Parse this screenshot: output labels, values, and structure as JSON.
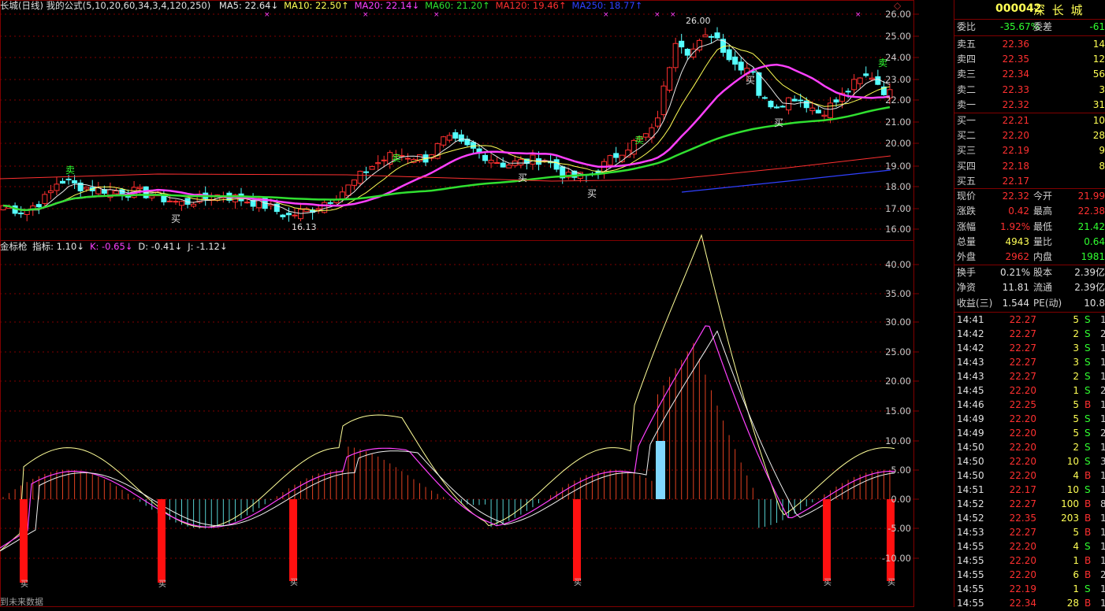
{
  "header": {
    "title": "长城(日线) 我的公式(5,10,20,60,34,3,4,120,250)",
    "ma": [
      {
        "label": "MA5: 22.64",
        "arrow": "↓",
        "color": "#e8e8e8"
      },
      {
        "label": "MA10: 22.50",
        "arrow": "↑",
        "color": "#ffff55"
      },
      {
        "label": "MA20: 22.14",
        "arrow": "↓",
        "color": "#ff40ff"
      },
      {
        "label": "MA60: 21.20",
        "arrow": "↑",
        "color": "#30e030"
      },
      {
        "label": "MA120: 19.46",
        "arrow": "↑",
        "color": "#ff3030"
      },
      {
        "label": "MA250: 18.77",
        "arrow": "↑",
        "color": "#3040ff"
      }
    ],
    "corner_icon": "diamond-icon"
  },
  "indicator": {
    "name": "金标枪",
    "items": [
      {
        "label": "指标: 1.10",
        "arrow": "↓",
        "color": "#e8e8e8"
      },
      {
        "label": "K: -0.65",
        "arrow": "↓",
        "color": "#ff40ff"
      },
      {
        "label": "D: -0.41",
        "arrow": "↓",
        "color": "#e8e8e8"
      },
      {
        "label": "J: -1.12",
        "arrow": "↓",
        "color": "#e8e8e8"
      }
    ]
  },
  "footer_text": "到未来数据",
  "price_axis": [
    "26.00",
    "25.00",
    "24.00",
    "23.00",
    "22.00",
    "21.00",
    "20.00",
    "19.00",
    "18.00",
    "17.00",
    "16.00"
  ],
  "indicator_axis": [
    "40.00",
    "35.00",
    "30.00",
    "25.00",
    "20.00",
    "15.00",
    "10.00",
    "5.00",
    "0.00",
    "-5.00",
    "-10.00"
  ],
  "annotations": {
    "high": "26.00",
    "low": "16.13",
    "buy": "买",
    "sell": "卖",
    "buy_marker": "买"
  },
  "quote": {
    "code": "000042",
    "name": "深 长 城",
    "ratio": {
      "label": "委比",
      "value": "-35.67%",
      "label2": "委差",
      "value2": "-61"
    },
    "asks": [
      {
        "label": "卖五",
        "price": "22.36",
        "vol": "14"
      },
      {
        "label": "卖四",
        "price": "22.35",
        "vol": "12"
      },
      {
        "label": "卖三",
        "price": "22.34",
        "vol": "56"
      },
      {
        "label": "卖二",
        "price": "22.33",
        "vol": "3"
      },
      {
        "label": "卖一",
        "price": "22.32",
        "vol": "31"
      }
    ],
    "bids": [
      {
        "label": "买一",
        "price": "22.21",
        "vol": "10"
      },
      {
        "label": "买二",
        "price": "22.20",
        "vol": "28"
      },
      {
        "label": "买三",
        "price": "22.19",
        "vol": "9"
      },
      {
        "label": "买四",
        "price": "22.18",
        "vol": "8"
      },
      {
        "label": "买五",
        "price": "22.17",
        "vol": ""
      }
    ],
    "stats": [
      {
        "l1": "现价",
        "v1": "22.32",
        "c1": "red",
        "l2": "今开",
        "v2": "21.99",
        "c2": "red"
      },
      {
        "l1": "涨跌",
        "v1": "0.42",
        "c1": "red",
        "l2": "最高",
        "v2": "22.38",
        "c2": "red"
      },
      {
        "l1": "涨幅",
        "v1": "1.92%",
        "c1": "red",
        "l2": "最低",
        "v2": "21.42",
        "c2": "green"
      },
      {
        "l1": "总量",
        "v1": "4943",
        "c1": "yellow",
        "l2": "量比",
        "v2": "0.64",
        "c2": "green"
      },
      {
        "l1": "外盘",
        "v1": "2962",
        "c1": "red",
        "l2": "内盘",
        "v2": "1981",
        "c2": "green"
      }
    ],
    "stats2": [
      {
        "l1": "换手",
        "v1": "0.21%",
        "l2": "股本",
        "v2": "2.39亿"
      },
      {
        "l1": "净资",
        "v1": "11.81",
        "l2": "流通",
        "v2": "2.39亿"
      },
      {
        "l1": "收益(三)",
        "v1": "1.544",
        "l2": "PE(动)",
        "v2": "10.8"
      }
    ]
  },
  "ticks": [
    {
      "t": "14:41",
      "p": "22.27",
      "v": "5",
      "f": "S",
      "x": "1"
    },
    {
      "t": "14:42",
      "p": "22.27",
      "v": "2",
      "f": "S",
      "x": "2"
    },
    {
      "t": "14:42",
      "p": "22.27",
      "v": "3",
      "f": "S",
      "x": "1"
    },
    {
      "t": "14:43",
      "p": "22.27",
      "v": "3",
      "f": "S",
      "x": "1"
    },
    {
      "t": "14:43",
      "p": "22.27",
      "v": "2",
      "f": "S",
      "x": "1"
    },
    {
      "t": "14:45",
      "p": "22.20",
      "v": "1",
      "f": "S",
      "x": "2"
    },
    {
      "t": "14:46",
      "p": "22.25",
      "v": "5",
      "f": "B",
      "x": "1"
    },
    {
      "t": "14:49",
      "p": "22.20",
      "v": "5",
      "f": "S",
      "x": "1"
    },
    {
      "t": "14:49",
      "p": "22.20",
      "v": "5",
      "f": "S",
      "x": "2"
    },
    {
      "t": "14:50",
      "p": "22.20",
      "v": "2",
      "f": "S",
      "x": "1"
    },
    {
      "t": "14:50",
      "p": "22.20",
      "v": "10",
      "f": "S",
      "x": "3"
    },
    {
      "t": "14:50",
      "p": "22.20",
      "v": "4",
      "f": "B",
      "x": "1"
    },
    {
      "t": "14:51",
      "p": "22.17",
      "v": "10",
      "f": "S",
      "x": "1"
    },
    {
      "t": "14:52",
      "p": "22.27",
      "v": "100",
      "f": "B",
      "x": "8"
    },
    {
      "t": "14:52",
      "p": "22.35",
      "v": "203",
      "f": "B",
      "x": "19"
    },
    {
      "t": "14:53",
      "p": "22.27",
      "v": "5",
      "f": "B",
      "x": "1"
    },
    {
      "t": "14:55",
      "p": "22.20",
      "v": "4",
      "f": "S",
      "x": "1"
    },
    {
      "t": "14:55",
      "p": "22.20",
      "v": "1",
      "f": "B",
      "x": "1"
    },
    {
      "t": "14:55",
      "p": "22.20",
      "v": "6",
      "f": "B",
      "x": "2"
    },
    {
      "t": "14:55",
      "p": "22.19",
      "v": "1",
      "f": "S",
      "x": "1"
    },
    {
      "t": "14:55",
      "p": "22.34",
      "v": "28",
      "f": "B",
      "x": "1"
    }
  ],
  "colors": {
    "up": "#ff3030",
    "down": "#55ffff",
    "grid": "#800000",
    "ma5": "#e8e8e8",
    "ma10": "#ffff55",
    "ma20": "#ff40ff",
    "ma60": "#30e030",
    "ma120": "#ff3030",
    "ma250": "#3040ff"
  }
}
